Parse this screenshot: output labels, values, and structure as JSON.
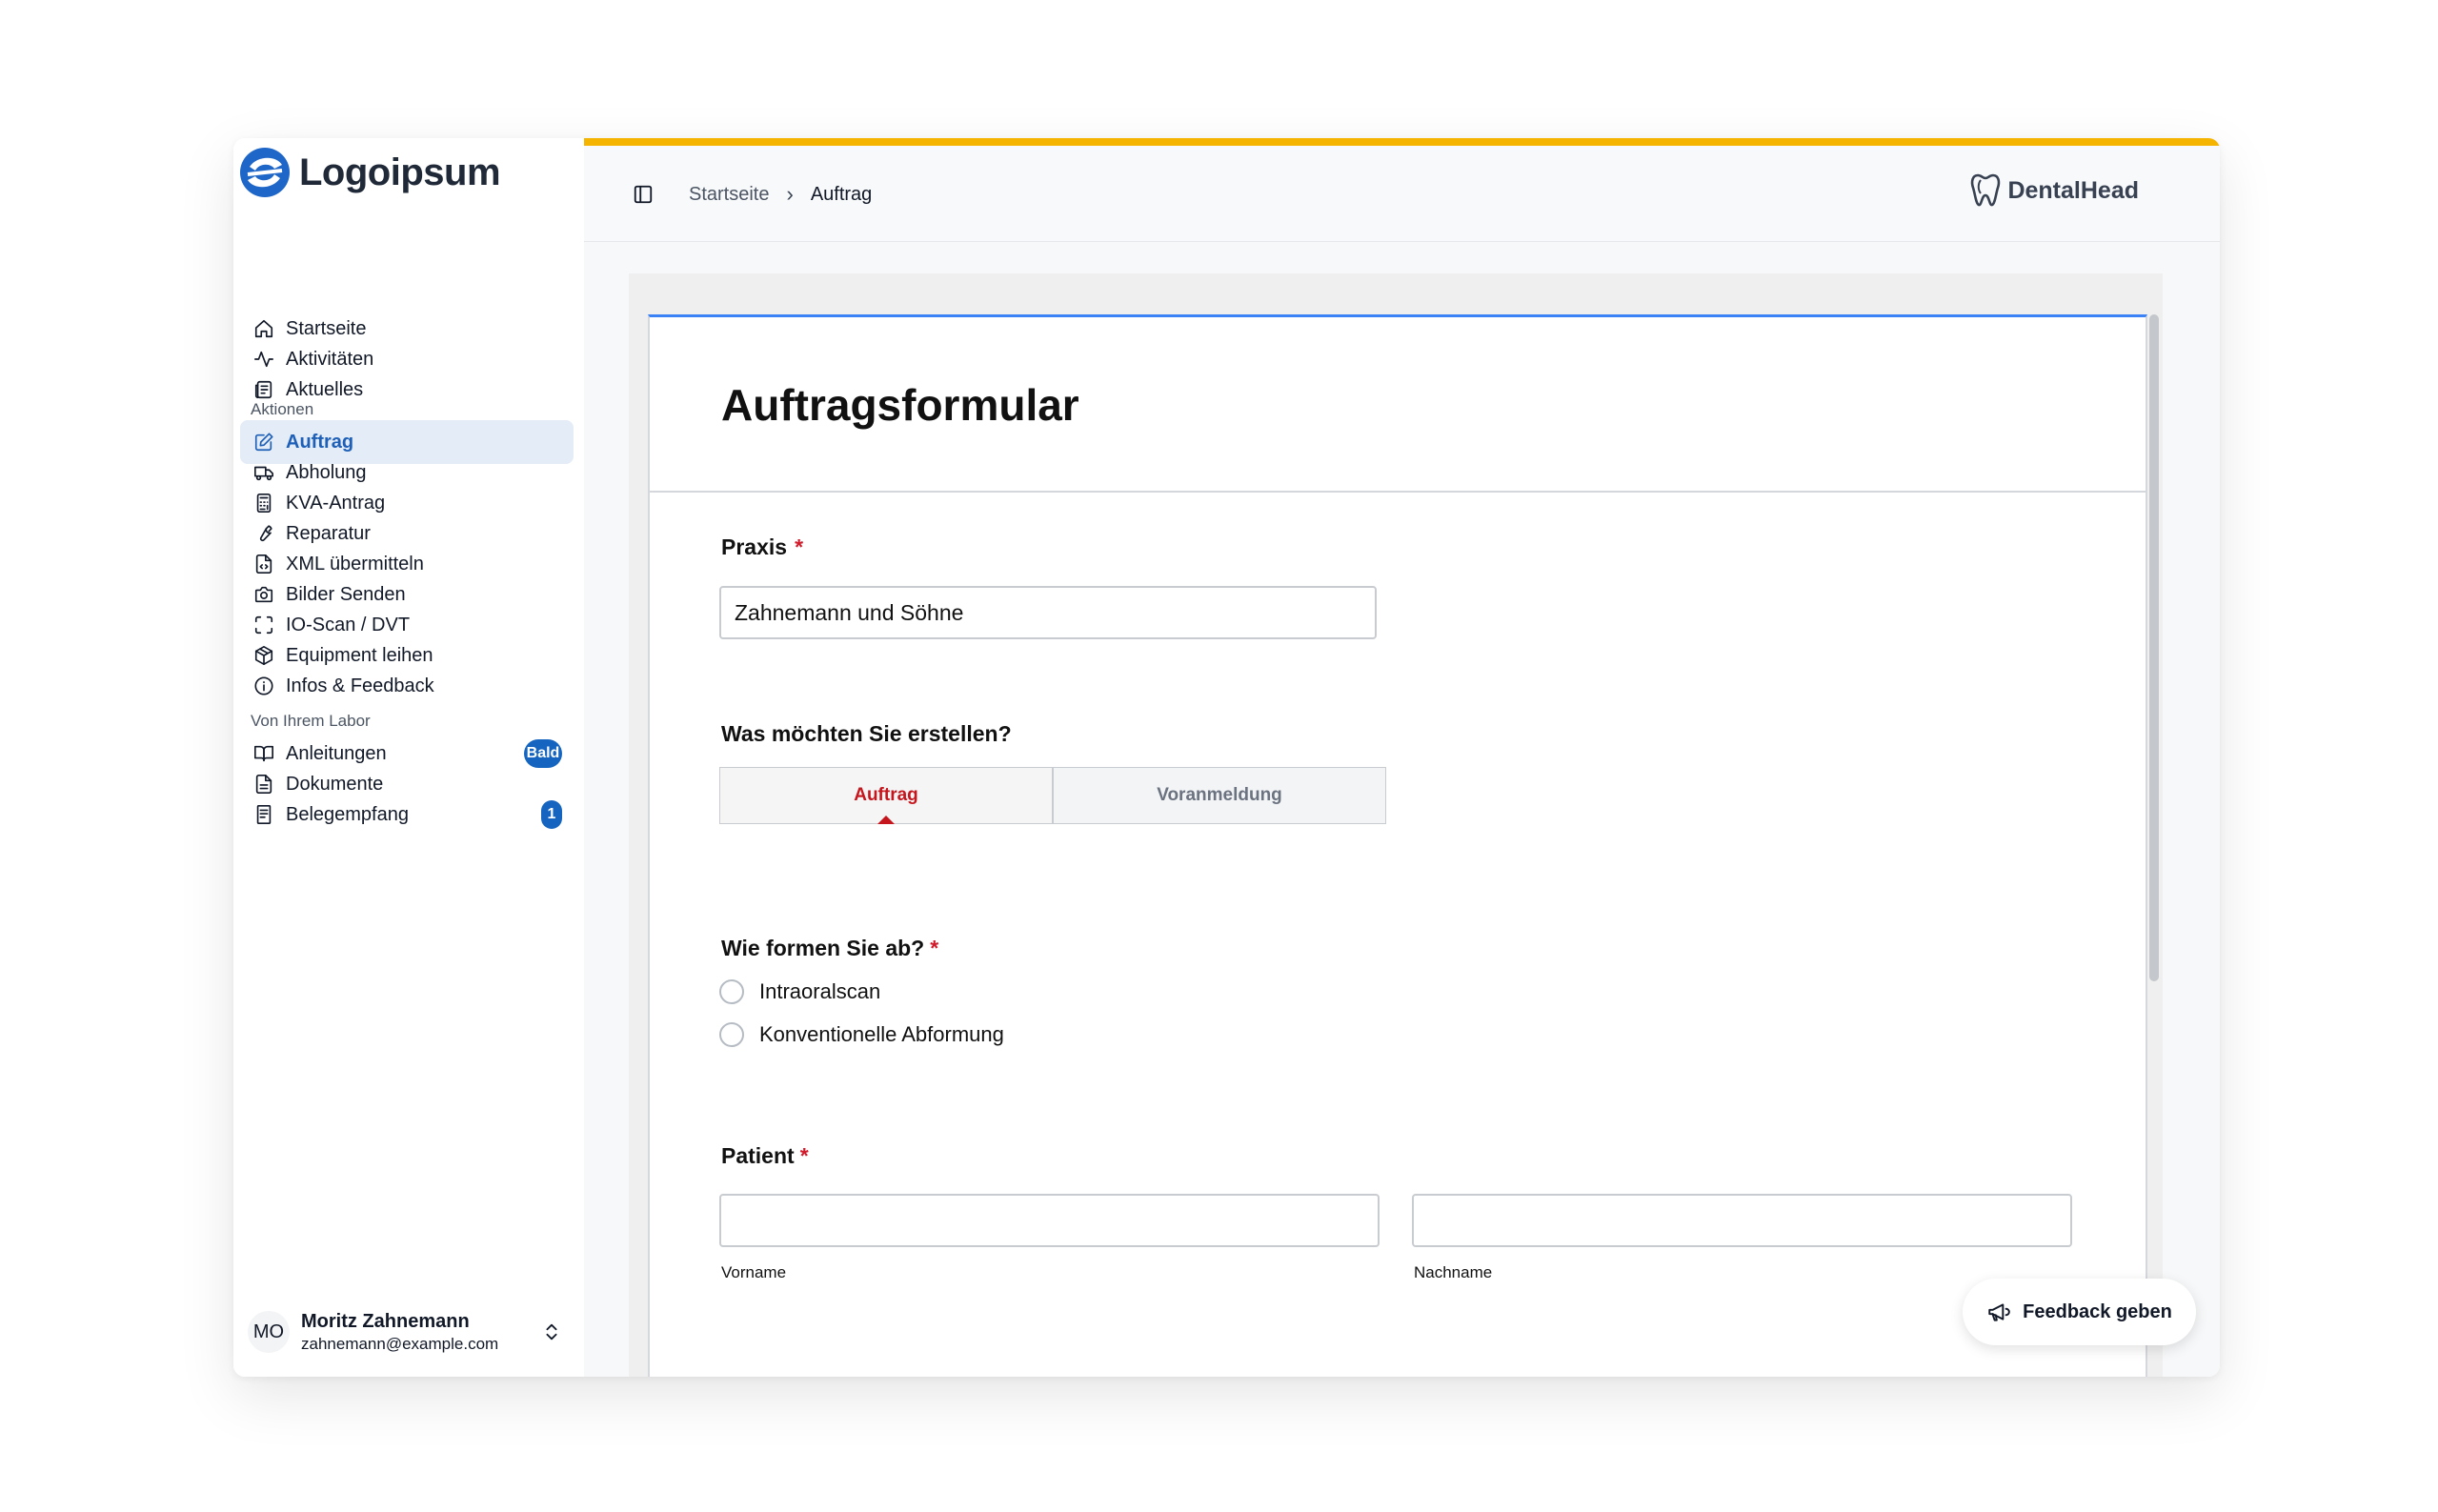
{
  "logo": {
    "text": "Logoipsum"
  },
  "sidebar": {
    "main_items": [
      {
        "label": "Startseite",
        "icon": "home-icon"
      },
      {
        "label": "Aktivitäten",
        "icon": "activity-icon"
      },
      {
        "label": "Aktuelles",
        "icon": "newspaper-icon"
      }
    ],
    "actions_label": "Aktionen",
    "actions": [
      {
        "label": "Auftrag",
        "icon": "edit-icon",
        "active": true
      },
      {
        "label": "Abholung",
        "icon": "truck-icon"
      },
      {
        "label": "KVA-Antrag",
        "icon": "calculator-icon"
      },
      {
        "label": "Reparatur",
        "icon": "wrench-icon"
      },
      {
        "label": "XML übermitteln",
        "icon": "file-code-icon"
      },
      {
        "label": "Bilder Senden",
        "icon": "camera-icon"
      },
      {
        "label": "IO-Scan / DVT",
        "icon": "scan-icon"
      },
      {
        "label": "Equipment leihen",
        "icon": "package-icon"
      },
      {
        "label": "Infos & Feedback",
        "icon": "info-icon"
      }
    ],
    "labor_label": "Von Ihrem Labor",
    "labor": [
      {
        "label": "Anleitungen",
        "icon": "book-icon",
        "badge": "Bald"
      },
      {
        "label": "Dokumente",
        "icon": "document-icon"
      },
      {
        "label": "Belegempfang",
        "icon": "receipt-icon",
        "badge": "1"
      }
    ]
  },
  "user": {
    "initials": "MO",
    "name": "Moritz Zahnemann",
    "email": "zahnemann@example.com"
  },
  "header": {
    "breadcrumb_home": "Startseite",
    "breadcrumb_sep": "›",
    "breadcrumb_current": "Auftrag",
    "brand": "DentalHead",
    "accent_color": "#f5b400"
  },
  "form": {
    "title": "Auftragsformular",
    "praxis_label": "Praxis",
    "praxis_value": "Zahnemann und Söhne",
    "create_question": "Was möchten Sie erstellen?",
    "tabs": [
      "Auftrag",
      "Voranmeldung"
    ],
    "active_tab": "Auftrag",
    "impression_question": "Wie formen Sie ab?",
    "impression_options": [
      "Intraoralscan",
      "Konventionelle Abformung"
    ],
    "patient_label": "Patient",
    "firstname_label": "Vorname",
    "lastname_label": "Nachname",
    "required_mark": "*"
  },
  "feedback_button": {
    "label": "Feedback geben"
  },
  "colors": {
    "active_nav_bg": "#e3ecf7",
    "active_nav_text": "#1e5fb8",
    "badge": "#1565c0",
    "required": "#d11a2a"
  }
}
